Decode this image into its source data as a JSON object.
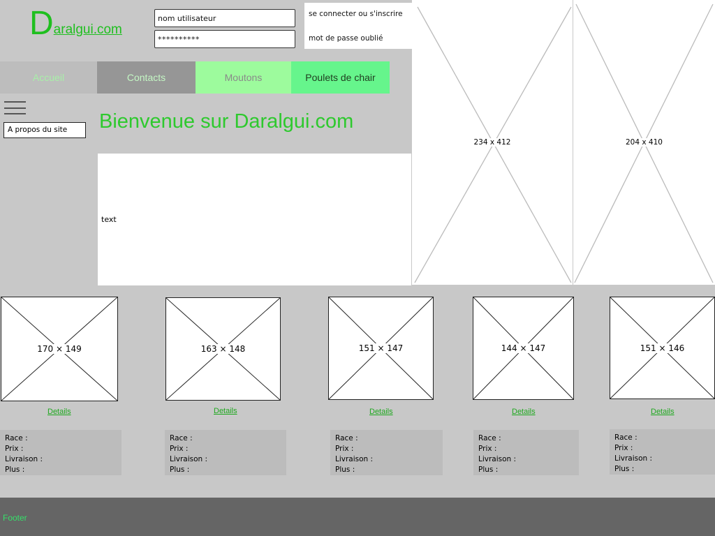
{
  "header": {
    "logo_initial": "D",
    "logo_rest": "aralgui.com",
    "username_value": "nom utilisateur",
    "password_value": "**********",
    "signin_link": "se connecter ou s'inscrire",
    "forgot_link": "mot de passe oublié"
  },
  "nav": {
    "items": [
      {
        "label": "Accueil"
      },
      {
        "label": "Contacts"
      },
      {
        "label": "Moutons"
      },
      {
        "label": "Poulets de chair"
      }
    ]
  },
  "sidebar": {
    "menu_icon": "hamburger-icon",
    "about_label": "A propos du site"
  },
  "main": {
    "title": "Bienvenue sur Daralgui.com",
    "body_text": "text"
  },
  "side_images": [
    {
      "label": "234 x 412"
    },
    {
      "label": "204 x 410"
    }
  ],
  "products": [
    {
      "image_label": "170 × 149",
      "details_label": "Details",
      "race_label": "Race :",
      "prix_label": "Prix :",
      "livraison_label": "Livraison :",
      "plus_label": "Plus :"
    },
    {
      "image_label": "163 × 148",
      "details_label": "Details",
      "race_label": "Race :",
      "prix_label": "Prix :",
      "livraison_label": "Livraison :",
      "plus_label": "Plus :"
    },
    {
      "image_label": "151 × 147",
      "details_label": "Details",
      "race_label": "Race :",
      "prix_label": "Prix :",
      "livraison_label": "Livraison :",
      "plus_label": "Plus :"
    },
    {
      "image_label": "144 × 147",
      "details_label": "Details",
      "race_label": "Race :",
      "prix_label": "Prix :",
      "livraison_label": "Livraison :",
      "plus_label": "Plus :"
    },
    {
      "image_label": "151 × 146",
      "details_label": "Details",
      "race_label": "Race :",
      "prix_label": "Prix :",
      "livraison_label": "Livraison :",
      "plus_label": "Plus :"
    }
  ],
  "footer": {
    "text": "Footer"
  },
  "colors": {
    "brand_green": "#1fbf1f",
    "title_green": "#2ec92e",
    "page_bg": "#c8c8c8",
    "footer_bg": "#656565"
  }
}
